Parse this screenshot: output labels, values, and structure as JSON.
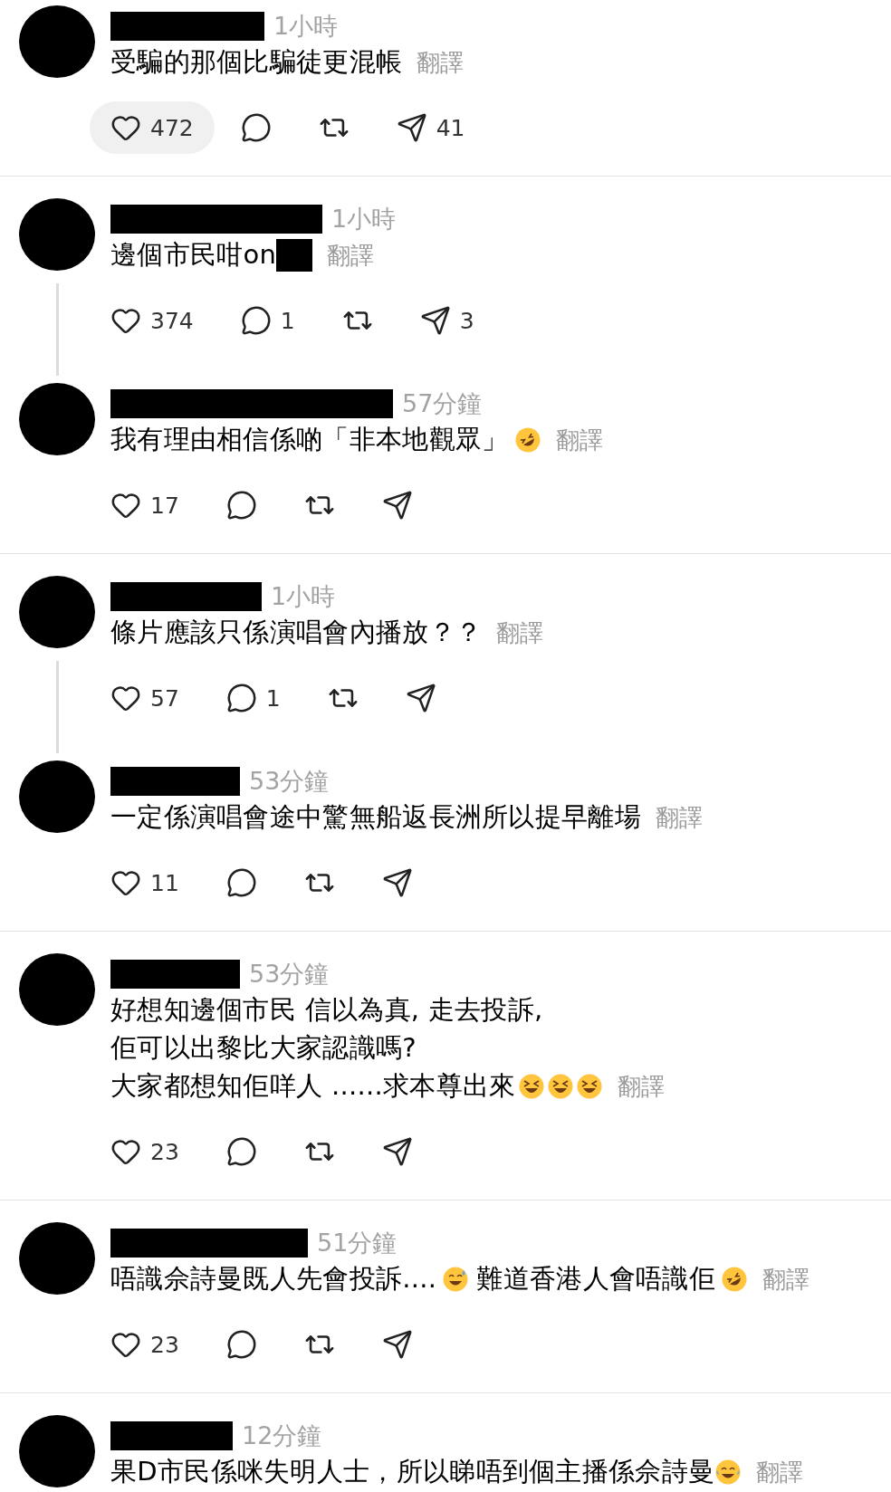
{
  "threads": [
    {
      "comments": [
        {
          "time": "1小時",
          "lines": [
            [
              {
                "kind": "text",
                "text": "受騙的那個比騙徒更混帳"
              }
            ]
          ],
          "translate": "翻譯",
          "actions": [
            {
              "kind": "like",
              "count": "472",
              "highlighted": true
            },
            {
              "kind": "reply",
              "highlighted": false
            },
            {
              "kind": "repost",
              "highlighted": false
            },
            {
              "kind": "share",
              "count": "41",
              "highlighted": false
            }
          ]
        }
      ]
    },
    {
      "comments": [
        {
          "time": "1小時",
          "lines": [
            [
              {
                "kind": "text",
                "text": "邊個市民咁on"
              },
              {
                "kind": "redaction"
              }
            ]
          ],
          "translate": "翻譯",
          "actions": [
            {
              "kind": "like",
              "count": "374",
              "highlighted": false
            },
            {
              "kind": "reply",
              "count": "1",
              "highlighted": false
            },
            {
              "kind": "repost",
              "highlighted": false
            },
            {
              "kind": "share",
              "count": "3",
              "highlighted": false
            }
          ]
        },
        {
          "time": "57分鐘",
          "lines": [
            [
              {
                "kind": "text",
                "text": "我有理由相信係啲「非本地觀眾」"
              },
              {
                "kind": "rofl"
              }
            ]
          ],
          "translate": "翻譯",
          "actions": [
            {
              "kind": "like",
              "count": "17",
              "highlighted": false
            },
            {
              "kind": "reply",
              "highlighted": false
            },
            {
              "kind": "repost",
              "highlighted": false
            },
            {
              "kind": "share",
              "highlighted": false
            }
          ]
        }
      ]
    },
    {
      "comments": [
        {
          "time": "1小時",
          "lines": [
            [
              {
                "kind": "text",
                "text": "條片應該只係演唱會內播放？？"
              }
            ]
          ],
          "translate": "翻譯",
          "actions": [
            {
              "kind": "like",
              "count": "57",
              "highlighted": false
            },
            {
              "kind": "reply",
              "count": "1",
              "highlighted": false
            },
            {
              "kind": "repost",
              "highlighted": false
            },
            {
              "kind": "share",
              "highlighted": false
            }
          ]
        },
        {
          "time": "53分鐘",
          "lines": [
            [
              {
                "kind": "text",
                "text": "一定係演唱會途中驚無船返長洲所以提早離場"
              }
            ]
          ],
          "translate": "翻譯",
          "actions": [
            {
              "kind": "like",
              "count": "11",
              "highlighted": false
            },
            {
              "kind": "reply",
              "highlighted": false
            },
            {
              "kind": "repost",
              "highlighted": false
            },
            {
              "kind": "share",
              "highlighted": false
            }
          ]
        }
      ]
    },
    {
      "comments": [
        {
          "time": "53分鐘",
          "lines": [
            [
              {
                "kind": "text",
                "text": "好想知邊個市民 信以為真, 走去投訴,"
              }
            ],
            [
              {
                "kind": "text",
                "text": "佢可以出黎比大家認識嗎?"
              }
            ],
            [
              {
                "kind": "text",
                "text": "大家都想知佢咩人 ......求本尊出來"
              },
              {
                "kind": "squint"
              },
              {
                "kind": "squint"
              },
              {
                "kind": "squint"
              }
            ]
          ],
          "translate": "翻譯",
          "actions": [
            {
              "kind": "like",
              "count": "23",
              "highlighted": false
            },
            {
              "kind": "reply",
              "highlighted": false
            },
            {
              "kind": "repost",
              "highlighted": false
            },
            {
              "kind": "share",
              "highlighted": false
            }
          ]
        }
      ]
    },
    {
      "comments": [
        {
          "time": "51分鐘",
          "lines": [
            [
              {
                "kind": "text",
                "text": "唔識佘詩曼既人先會投訴...."
              },
              {
                "kind": "sweat"
              },
              {
                "kind": "text",
                "text": "難道香港人會唔識佢"
              },
              {
                "kind": "rofl"
              }
            ]
          ],
          "translate": "翻譯",
          "actions": [
            {
              "kind": "like",
              "count": "23",
              "highlighted": false
            },
            {
              "kind": "reply",
              "highlighted": false
            },
            {
              "kind": "repost",
              "highlighted": false
            },
            {
              "kind": "share",
              "highlighted": false
            }
          ]
        }
      ]
    },
    {
      "comments": [
        {
          "time": "12分鐘",
          "lines": [
            [
              {
                "kind": "text",
                "text": "果D市民係咪失明人士，所以睇唔到個主播係佘詩曼"
              },
              {
                "kind": "joy"
              }
            ]
          ],
          "translate": "翻譯"
        }
      ]
    }
  ]
}
